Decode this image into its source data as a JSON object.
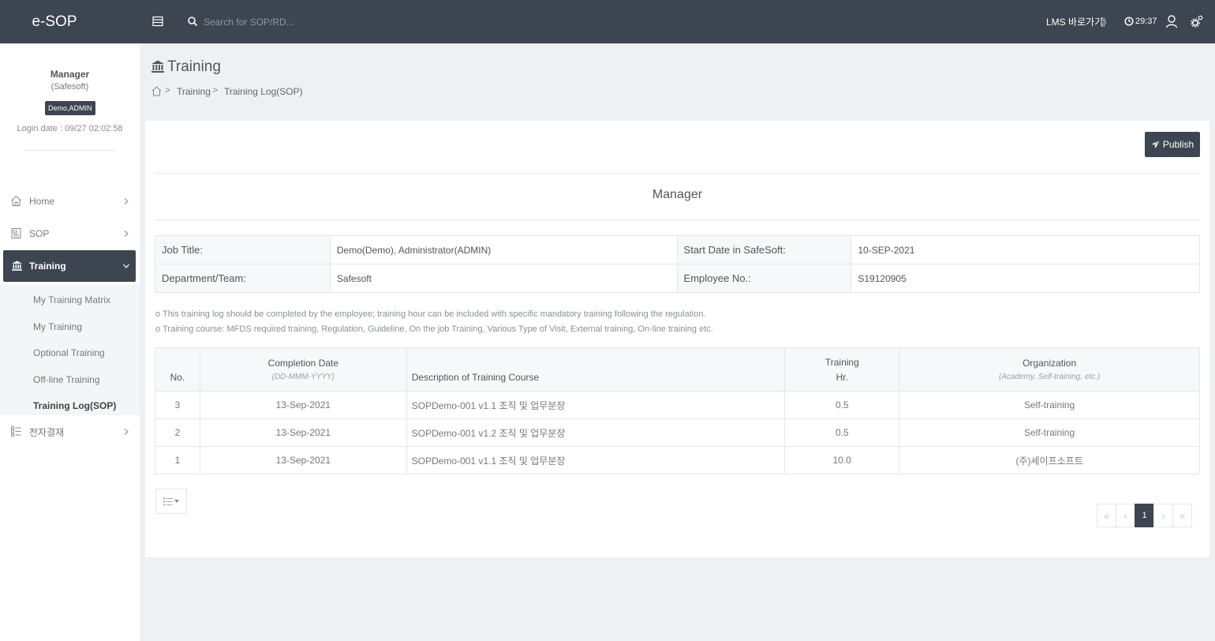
{
  "topbar": {
    "brand": "e-SOP",
    "search_placeholder": "Search for SOP/RD...",
    "lms_link": "LMS 바로가기",
    "lms_chevron": "》",
    "session_timer": "29:37"
  },
  "sidebar": {
    "profile": {
      "name": "Manager",
      "org": "(Safesoft)",
      "badge": "Demo,ADMIN",
      "login": "Login date : 09/27 02:02:58"
    },
    "items": [
      {
        "label": "Home",
        "icon": "home-icon"
      },
      {
        "label": "SOP",
        "icon": "document-icon"
      },
      {
        "label": "Training",
        "icon": "bank-icon"
      },
      {
        "label": "전자결재",
        "icon": "approval-icon"
      }
    ],
    "training_sub": [
      {
        "label": "My Training Matrix"
      },
      {
        "label": "My Training"
      },
      {
        "label": "Optional Training"
      },
      {
        "label": "Off-line Training"
      },
      {
        "label": "Training Log(SOP)"
      }
    ]
  },
  "page": {
    "title": "Training",
    "breadcrumb": [
      "Training",
      "Training Log(SOP)"
    ]
  },
  "card": {
    "publish": "Publish",
    "employee_name": "Manager",
    "info": {
      "job_title_label": "Job Title:",
      "job_title": "Demo(Demo), Administrator(ADMIN)",
      "start_date_label": "Start Date in SafeSoft:",
      "start_date": "10-SEP-2021",
      "department_label": "Department/Team:",
      "department": "Safesoft",
      "employee_no_label": "Employee No.:",
      "employee_no": "S19120905"
    },
    "notes": [
      "o This training log should be completed by the employee; training hour can be included with specific mandatory training following the regulation.",
      "o Training course: MFDS required training, Regulation, Guideline, On the job Training, Various Type of Visit, External training, On-line training etc."
    ],
    "table": {
      "headers": {
        "no": "No.",
        "date": "Completion Date",
        "date_sub": "(DD-MMM-YYYY)",
        "desc": "Description of Training Course",
        "hr_line1": "Training",
        "hr_line2": "Hr.",
        "org": "Organization",
        "org_sub": "(Academy, Self-training, etc.)"
      },
      "rows": [
        {
          "no": "3",
          "date": "13-Sep-2021",
          "desc": "SOPDemo-001 v1.1 조직 및 업무분장",
          "hr": "0.5",
          "org": "Self-training"
        },
        {
          "no": "2",
          "date": "13-Sep-2021",
          "desc": "SOPDemo-001 v1.2 조직 및 업무분장",
          "hr": "0.5",
          "org": "Self-training"
        },
        {
          "no": "1",
          "date": "13-Sep-2021",
          "desc": "SOPDemo-001 v1.1 조직 및 업무분장",
          "hr": "10.0",
          "org": "(주)세이프소프트"
        }
      ]
    },
    "pagination": {
      "first": "«",
      "prev": "‹",
      "current": "1",
      "next": "›",
      "last": "»"
    }
  },
  "colors": {
    "topbar": "#3d4550",
    "active_nav": "#3d4550",
    "page_bg": "#eef0f3"
  }
}
